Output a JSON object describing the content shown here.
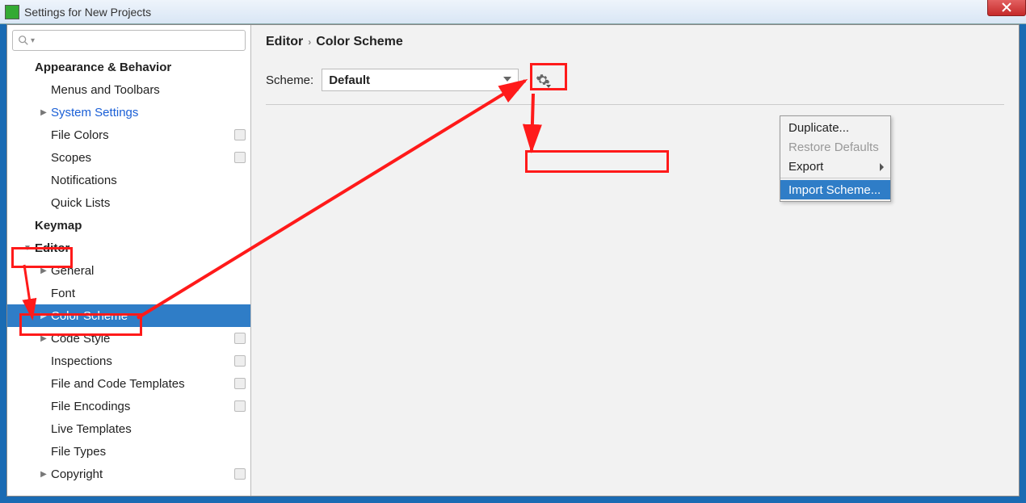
{
  "window": {
    "title": "Settings for New Projects"
  },
  "search": {
    "placeholder": ""
  },
  "tree": [
    {
      "label": "Appearance & Behavior",
      "bold": true,
      "level": 0,
      "arrow": "",
      "badge": false
    },
    {
      "label": "Menus and Toolbars",
      "level": 1,
      "arrow": "",
      "badge": false
    },
    {
      "label": "System Settings",
      "level": 1,
      "arrow": ">",
      "link": true,
      "badge": false
    },
    {
      "label": "File Colors",
      "level": 1,
      "arrow": "",
      "badge": true
    },
    {
      "label": "Scopes",
      "level": 1,
      "arrow": "",
      "badge": true
    },
    {
      "label": "Notifications",
      "level": 1,
      "arrow": "",
      "badge": false
    },
    {
      "label": "Quick Lists",
      "level": 1,
      "arrow": "",
      "badge": false
    },
    {
      "label": "Keymap",
      "bold": true,
      "level": 0,
      "arrow": "",
      "badge": false
    },
    {
      "label": "Editor",
      "bold": true,
      "level": 0,
      "arrow": "v",
      "badge": false
    },
    {
      "label": "General",
      "level": 1,
      "arrow": ">",
      "badge": false
    },
    {
      "label": "Font",
      "level": 1,
      "arrow": "",
      "badge": false
    },
    {
      "label": "Color Scheme",
      "level": 1,
      "arrow": ">",
      "sel": true,
      "badge": false
    },
    {
      "label": "Code Style",
      "level": 1,
      "arrow": ">",
      "badge": true
    },
    {
      "label": "Inspections",
      "level": 1,
      "arrow": "",
      "badge": true
    },
    {
      "label": "File and Code Templates",
      "level": 1,
      "arrow": "",
      "badge": true
    },
    {
      "label": "File Encodings",
      "level": 1,
      "arrow": "",
      "badge": true
    },
    {
      "label": "Live Templates",
      "level": 1,
      "arrow": "",
      "badge": false
    },
    {
      "label": "File Types",
      "level": 1,
      "arrow": "",
      "badge": false
    },
    {
      "label": "Copyright",
      "level": 1,
      "arrow": ">",
      "badge": true
    }
  ],
  "breadcrumb": {
    "parent": "Editor",
    "current": "Color Scheme"
  },
  "scheme": {
    "label": "Scheme:",
    "value": "Default"
  },
  "menu": {
    "duplicate": "Duplicate...",
    "restore": "Restore Defaults",
    "export": "Export",
    "import": "Import Scheme..."
  }
}
